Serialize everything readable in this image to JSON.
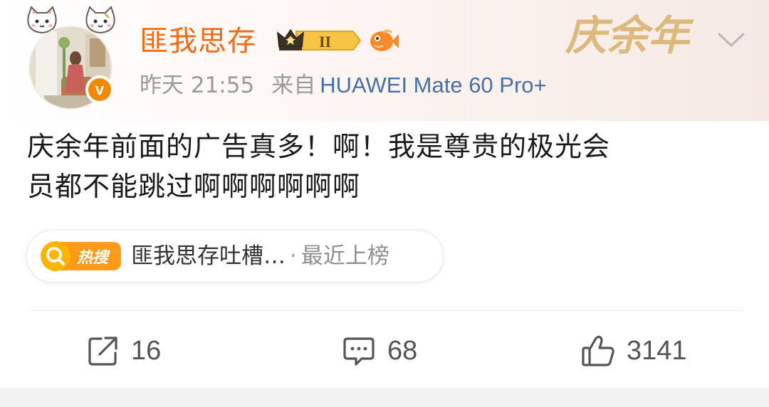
{
  "post": {
    "username": "匪我思存",
    "rank_level": "II",
    "time": "昨天 21:55",
    "from_label": "来自",
    "device": "HUAWEI Mate 60 Pro+",
    "content_lines": [
      "庆余年前面的广告真多！啊！我是尊贵的极光会",
      "员都不能跳过啊啊啊啊啊啊"
    ],
    "verified_mark": "v",
    "logo_text": "庆余年"
  },
  "hot_search": {
    "badge": "热搜",
    "title": "匪我思存吐槽…",
    "separator": "·",
    "status": "最近上榜"
  },
  "actions": {
    "repost_count": "16",
    "comment_count": "68",
    "like_count": "3141"
  },
  "icons": {
    "cat_left": "cat-sticker-icon",
    "cat_right": "cat-sticker-icon",
    "crown": "crown-rank-icon",
    "fish": "fish-badge-icon",
    "chevron": "chevron-down-icon",
    "repost": "repost-icon",
    "comment": "comment-icon",
    "like": "thumbs-up-icon",
    "hot_search": "search-icon"
  },
  "colors": {
    "username": "#f26a12",
    "device_link": "#4a6fa3",
    "verified": "#f08a00",
    "hot_badge": "#ff8a00"
  }
}
